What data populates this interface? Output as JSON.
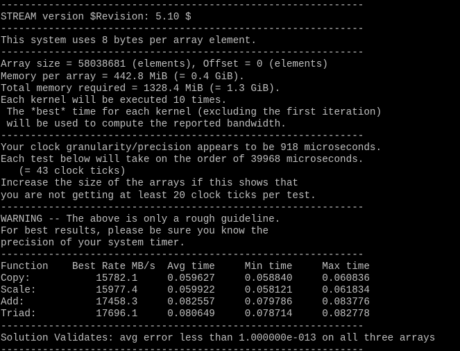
{
  "terminal": {
    "colors": {
      "background": "#000000",
      "foreground": "#c0c0c0"
    },
    "lines": [
      "-------------------------------------------------------------",
      "STREAM version $Revision: 5.10 $",
      "-------------------------------------------------------------",
      "This system uses 8 bytes per array element.",
      "-------------------------------------------------------------",
      "Array size = 58038681 (elements), Offset = 0 (elements)",
      "Memory per array = 442.8 MiB (= 0.4 GiB).",
      "Total memory required = 1328.4 MiB (= 1.3 GiB).",
      "Each kernel will be executed 10 times.",
      " The *best* time for each kernel (excluding the first iteration)",
      " will be used to compute the reported bandwidth.",
      "-------------------------------------------------------------",
      "Your clock granularity/precision appears to be 918 microseconds.",
      "Each test below will take on the order of 39968 microseconds.",
      "   (= 43 clock ticks)",
      "Increase the size of the arrays if this shows that",
      "you are not getting at least 20 clock ticks per test.",
      "-------------------------------------------------------------",
      "WARNING -- The above is only a rough guideline.",
      "For best results, please be sure you know the",
      "precision of your system timer.",
      "-------------------------------------------------------------",
      "Function    Best Rate MB/s  Avg time     Min time     Max time",
      "Copy:           15782.1     0.059627     0.058840     0.060836",
      "Scale:          15977.4     0.059922     0.058121     0.061834",
      "Add:            17458.3     0.082557     0.079786     0.083776",
      "Triad:          17696.1     0.080649     0.078714     0.082778",
      "-------------------------------------------------------------",
      "Solution Validates: avg error less than 1.000000e-013 on all three arrays",
      "-------------------------------------------------------------"
    ]
  }
}
